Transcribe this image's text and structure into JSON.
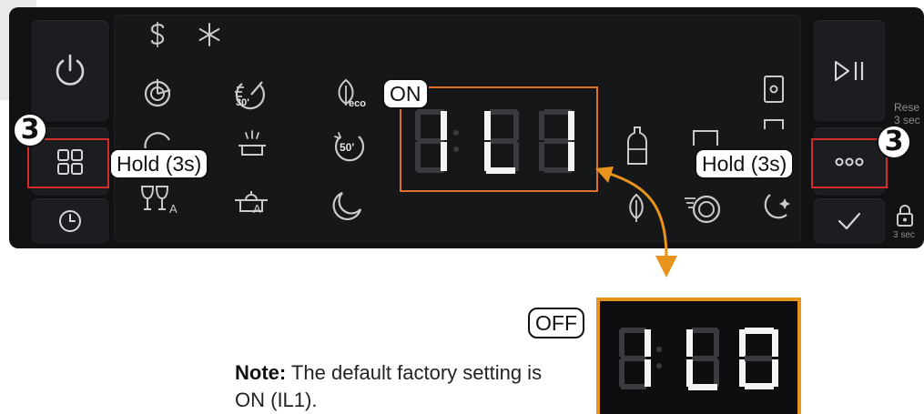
{
  "callouts": {
    "on_label": "ON",
    "off_label": "OFF",
    "hold_left": "Hold (3s)",
    "hold_right": "Hold (3s)",
    "step_left": "3",
    "step_right": "3"
  },
  "display": {
    "on_value": "1:L1",
    "off_value": "1:L0"
  },
  "side_labels": {
    "reset_line1": "Rese",
    "reset_line2": "3 sec",
    "lock_time": "3 sec"
  },
  "badges": {
    "eco": "eco",
    "time_30": "30'",
    "time_50": "50'",
    "letter_a1": "A",
    "letter_a2": "A"
  },
  "note": {
    "bold": "Note:",
    "text": " The default factory setting is ON (IL1)."
  },
  "icons": [
    "power-icon",
    "menu-grid-icon",
    "clock-icon",
    "play-pause-icon",
    "more-options-icon",
    "check-icon",
    "sanitize-icon",
    "snowflake-icon",
    "auto-icon",
    "quick-30-icon",
    "eco-leaf-icon",
    "quick-50-icon",
    "half-load-icon",
    "glass-icon",
    "pot-icon",
    "night-icon",
    "bottle-icon",
    "leaf-icon",
    "intensive-icon",
    "night-star-icon",
    "door-icon",
    "lock-icon"
  ],
  "colors": {
    "highlight_red": "#d42b2b",
    "highlight_orange": "#e0712a",
    "arrow_orange": "#e8931b",
    "panel_dark": "#111214",
    "icon_gray": "#c9cacc"
  }
}
